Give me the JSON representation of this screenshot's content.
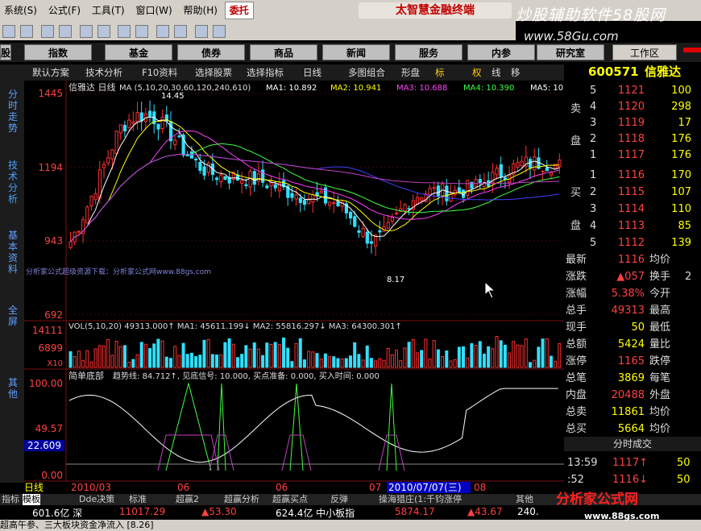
{
  "menubar": {
    "items": [
      "系统(S)",
      "公式(F)",
      "工具(T)",
      "窗口(W)",
      "帮助(H)"
    ],
    "entrust": "委托",
    "brand": "太智慧金融终端"
  },
  "watermark": {
    "title": "炒股辅助软件58股网",
    "url": "www.58Gu.com"
  },
  "nav": {
    "items": [
      "股",
      "指数",
      "基金",
      "债券",
      "商品",
      "新闻",
      "服务",
      "内参",
      "研究室"
    ],
    "workarea": "工作区"
  },
  "sidetabs": [
    "分时走势",
    "技术分析",
    "基本资料",
    "全屏",
    "其他"
  ],
  "chartbar": {
    "items": [
      "默认方案",
      "技术分析",
      "F10资料",
      "选择股票",
      "选择指标",
      "日线",
      "多图组合",
      "形盘"
    ],
    "letters": [
      "标",
      "权",
      "线",
      "移"
    ],
    "code": "600571",
    "name": "信雅达"
  },
  "main_panel": {
    "title": "信雅达 日线",
    "ma_header": "MA (5,10,20,30,60,120,240,610)",
    "ma": [
      {
        "label": "MA1: 10.892",
        "color": "#ffffff"
      },
      {
        "label": "MA2: 10.941",
        "color": "#ffff00"
      },
      {
        "label": "MA3: 10.688",
        "color": "#ff40ff"
      },
      {
        "label": "MA4: 10.390",
        "color": "#40ff40"
      },
      {
        "label": "MA5: 10",
        "color": "#ffffff"
      }
    ],
    "y_ticks": [
      "1445",
      "1194",
      "943",
      "692"
    ],
    "hi_label": "14.45",
    "lo_label": "8.17",
    "overlay_text": "分析家公式超级资源下载：分析家公式网www.88gs.com"
  },
  "vol_panel": {
    "header": "VOL(5,10,20)  49313.000↑  MA1: 45611.199↓  MA2: 55816.297↓  MA3: 64300.301↑",
    "y_ticks": [
      "14111",
      "6899",
      "X10"
    ]
  },
  "ind_panel": {
    "name": "简单底部",
    "header": "趋势线: 84.712↑, 见底信号: 10.000, 买点准备: 0.000, 买入时间: 0.000",
    "y_ticks": [
      "100.00",
      "49.57",
      "22.609",
      "0.00"
    ]
  },
  "xaxis": {
    "labels": [
      "日线",
      "2010/03",
      "06",
      "06",
      "07",
      "2010/07/07(三)",
      "08"
    ]
  },
  "chart_data": {
    "type": "candlestick",
    "title": "信雅达 日线",
    "ylim": [
      6.92,
      14.45
    ],
    "marked_high": 14.45,
    "marked_low": 8.17
  },
  "quotes": {
    "asks": [
      {
        "n": "5",
        "p": "1121",
        "v": "100"
      },
      {
        "n": "4",
        "p": "1120",
        "v": "298"
      },
      {
        "n": "3",
        "p": "1119",
        "v": "17"
      },
      {
        "n": "2",
        "p": "1118",
        "v": "176"
      },
      {
        "n": "1",
        "p": "1117",
        "v": "176"
      }
    ],
    "bids": [
      {
        "n": "1",
        "p": "1116",
        "v": "170"
      },
      {
        "n": "2",
        "p": "1115",
        "v": "107"
      },
      {
        "n": "3",
        "p": "1114",
        "v": "110"
      },
      {
        "n": "4",
        "p": "1113",
        "v": "85"
      },
      {
        "n": "5",
        "p": "1112",
        "v": "139"
      }
    ],
    "sell_label": [
      "卖",
      "盘"
    ],
    "buy_label": [
      "买",
      "盘"
    ],
    "stats": [
      [
        "最新",
        "1116",
        "均价",
        ""
      ],
      [
        "涨跌",
        "▲057",
        "换手",
        "2"
      ],
      [
        "涨幅",
        "5.38%",
        "今开",
        ""
      ],
      [
        "总手",
        "49313",
        "最高",
        ""
      ],
      [
        "现手",
        "50",
        "最低",
        ""
      ],
      [
        "总额",
        "5424",
        "量比",
        ""
      ],
      [
        "涨停",
        "1165",
        "跌停",
        ""
      ],
      [
        "总笔",
        "3869",
        "每笔",
        ""
      ],
      [
        "内盘",
        "20488",
        "外盘",
        ""
      ],
      [
        "总卖",
        "11861",
        "均价",
        ""
      ],
      [
        "总买",
        "5664",
        "均价",
        ""
      ]
    ],
    "tick_title": "分时成交",
    "ticks": [
      {
        "t": "13:59",
        "p": "1117↑",
        "v": "50"
      },
      {
        "t": ":52",
        "p": "1116↓",
        "v": "50"
      }
    ]
  },
  "bottom_tabs": [
    "指标",
    "模板",
    "Dde决策",
    "标准",
    "超赢2",
    "超赢分析",
    "超赢买点",
    "反弹",
    "操海猎庄(1:千钧涨停",
    "其他"
  ],
  "index_bar": {
    "a": "601.6亿 深",
    "b": "11017.29",
    "c": "▲53.30",
    "d": "624.4亿 中小板指",
    "e": "5874.17",
    "f": "▲43.67",
    "g": "240."
  },
  "ticker": "超高午参、三大板块资金净流入 [8.26]",
  "logo": {
    "name": "分析家公式网",
    "url": "www.88gs.com"
  }
}
